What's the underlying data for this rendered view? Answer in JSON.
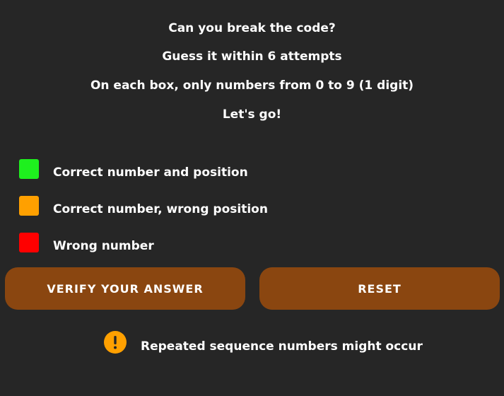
{
  "intro": {
    "title": "Can you break the code?",
    "attempts": "Guess it within 6 attempts",
    "rule": "On each box, only numbers from 0 to 9 (1 digit)",
    "start": "Let's go!"
  },
  "legend": [
    {
      "label": "Correct number and position",
      "color": "#1ef01e"
    },
    {
      "label": "Correct number, wrong position",
      "color": "#ffa000"
    },
    {
      "label": "Wrong number",
      "color": "#ff0000"
    }
  ],
  "buttons": {
    "verify_label": "VERIFY YOUR ANSWER",
    "reset_label": "RESET",
    "color": "#8a4610"
  },
  "warning": {
    "icon": "exclamation-circle-icon",
    "text": "Repeated sequence numbers might occur",
    "color": "#ffa000"
  }
}
